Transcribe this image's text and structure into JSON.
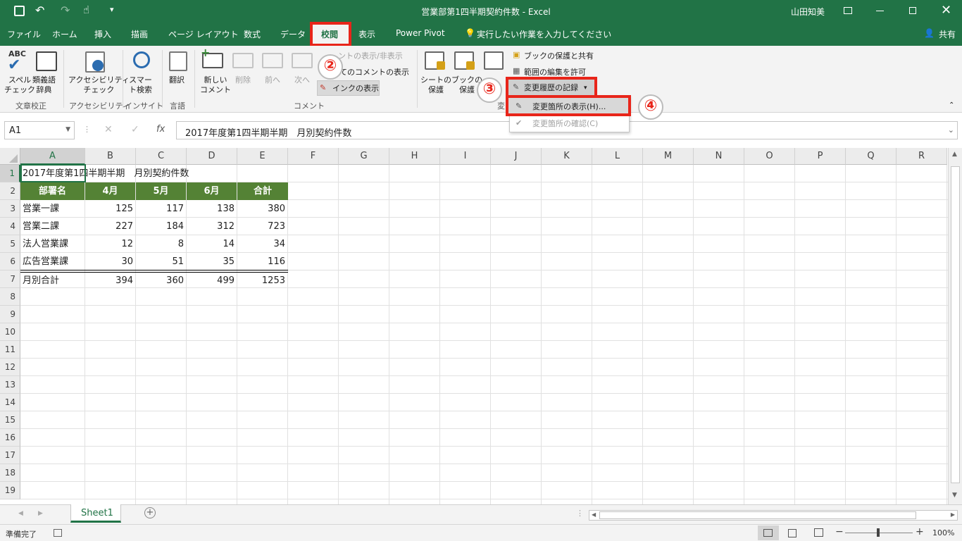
{
  "window": {
    "title": "営業部第1四半期契約件数 - Excel",
    "user": "山田知美"
  },
  "tabs": [
    "ファイル",
    "ホーム",
    "挿入",
    "描画",
    "ページ レイアウト",
    "数式",
    "データ",
    "校閲",
    "表示",
    "Power Pivot"
  ],
  "tell_me": "実行したい作業を入力してください",
  "share": "共有",
  "ribbon": {
    "spell": "スペル\nチェック",
    "thesaurus": "類義語\n辞典",
    "accessibility": "アクセシビリティ\nチェック",
    "smart": "スマー\nト検索",
    "translate": "翻訳",
    "new_comment": "新しい\nコメント",
    "delete": "削除",
    "prev": "前へ",
    "next": "次へ",
    "toggle_comment": "ントの表示/非表示",
    "show_all": "てのコメントの表示",
    "ink": "インクの表示",
    "protect_sheet": "シートの\n保護",
    "protect_book": "ブックの\n保護",
    "share_book": "ブックの保護と共有",
    "allow_edit": "範囲の編集を許可",
    "track_changes": "変更履歴の記録",
    "groups": {
      "proof": "文章校正",
      "access": "アクセシビリティ",
      "insight": "インサイト",
      "lang": "言語",
      "comment": "コメント",
      "change": "変"
    },
    "menu": {
      "highlight": "変更箇所の表示(H)...",
      "accept": "変更箇所の確認(C)"
    },
    "steps": {
      "s2": "②",
      "s3": "③",
      "s4": "④"
    },
    "abc": "ABC"
  },
  "formula": {
    "namebox": "A1",
    "fx": "fx",
    "content": "2017年度第1四半期半期　月別契約件数"
  },
  "columns": [
    "A",
    "B",
    "C",
    "D",
    "E",
    "F",
    "G",
    "H",
    "I",
    "J",
    "K",
    "L",
    "M",
    "N",
    "O",
    "P",
    "Q",
    "R"
  ],
  "rows": [
    "1",
    "2",
    "3",
    "4",
    "5",
    "6",
    "7",
    "8",
    "9",
    "10",
    "11",
    "12",
    "13",
    "14",
    "15",
    "16",
    "17",
    "18",
    "19"
  ],
  "sheet": {
    "title": "2017年度第1四半期半期　月別契約件数",
    "header": [
      "部署名",
      "4月",
      "5月",
      "6月",
      "合計"
    ],
    "data": [
      [
        "営業一課",
        "125",
        "117",
        "138",
        "380"
      ],
      [
        "営業二課",
        "227",
        "184",
        "312",
        "723"
      ],
      [
        "法人営業課",
        "12",
        "8",
        "14",
        "34"
      ],
      [
        "広告営業課",
        "30",
        "51",
        "35",
        "116"
      ]
    ],
    "total": [
      "月別合計",
      "394",
      "360",
      "499",
      "1253"
    ]
  },
  "sheet_tab": "Sheet1",
  "status": {
    "ready": "準備完了",
    "zoom": "100%"
  },
  "colors": {
    "excel_green": "#217346",
    "header_fill": "#548235",
    "highlight_red": "#e8251a"
  }
}
